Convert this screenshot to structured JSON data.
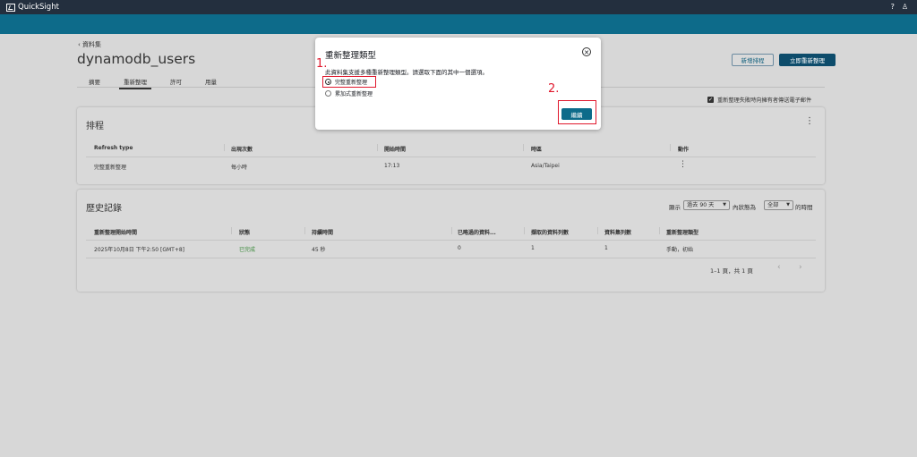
{
  "app": {
    "name": "QuickSight"
  },
  "breadcrumb": {
    "label": "資料集"
  },
  "dataset": {
    "title": "dynamodb_users"
  },
  "tabs": [
    {
      "label": "摘要"
    },
    {
      "label": "重新整理"
    },
    {
      "label": "許可"
    },
    {
      "label": "用量"
    }
  ],
  "toolbar": {
    "add_schedule": "新增排程",
    "refresh_now": "立即重新整理"
  },
  "notify": {
    "label": "重新整理失敗時向擁有者傳送電子郵件"
  },
  "schedule": {
    "title": "排程",
    "headers": [
      "Refresh type",
      "出現次數",
      "開始時間",
      "時區",
      "動作"
    ],
    "rows": [
      {
        "type": "完整重新整理",
        "frequency": "每小時",
        "start": "17:13",
        "timezone": "Asia/Taipei"
      }
    ]
  },
  "history": {
    "title": "歷史記錄",
    "filter_prefix": "顯示",
    "range_value": "過去 90 天",
    "status_prefix": "內狀態為",
    "status_value": "全部",
    "filter_suffix": "的時間",
    "headers": [
      "重新整理開始時間",
      "狀態",
      "持續時間",
      "已略過的資料...",
      "擷取的資料列數",
      "資料集列數",
      "重新整理類型"
    ],
    "rows": [
      {
        "start": "2025年10月8日 下午2:50 [GMT+8]",
        "status": "已完成",
        "duration": "45 秒",
        "skipped": "0",
        "ingested": "1",
        "rows": "1",
        "type": "手動，初始"
      }
    ],
    "pagination": "1–1 頁，共 1 頁"
  },
  "dialog": {
    "title": "重新整理類型",
    "description": "此資料集支援多種重新整理類型。請選取下面的其中一個選項。",
    "options": [
      {
        "label": "完整重新整理",
        "selected": true
      },
      {
        "label": "累加式重新整理",
        "selected": false
      }
    ],
    "continue_label": "繼續"
  },
  "annotations": {
    "step1": "1.",
    "step2": "2."
  },
  "colors": {
    "header": "#232f3e",
    "accent": "#0d6b8a",
    "primary_button": "#0d4c6b",
    "highlight": "#e0182d",
    "success": "#3a8a3a"
  }
}
